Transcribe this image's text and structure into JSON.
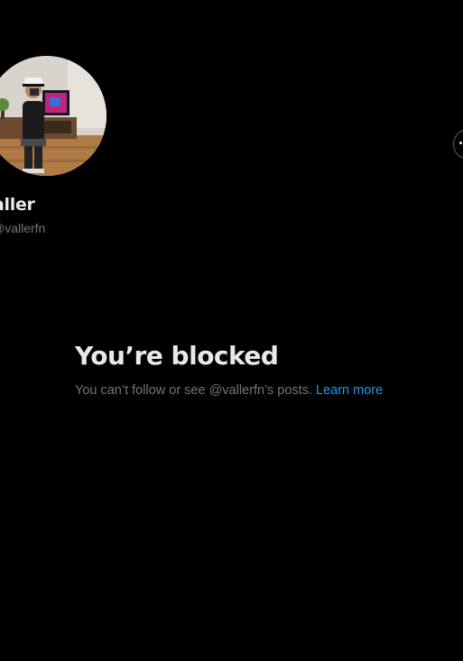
{
  "profile": {
    "display_name": "aller",
    "handle": "@vallerfn"
  },
  "blocked": {
    "title": "You’re blocked",
    "description": "You can’t follow or see @vallerfn’s posts.",
    "link_label": "Learn more"
  },
  "icons": {
    "more": "more-options-icon"
  },
  "colors": {
    "background": "#000000",
    "primary_text": "#e7e9ea",
    "secondary_text": "#71767b",
    "link": "#1d9bf0"
  }
}
